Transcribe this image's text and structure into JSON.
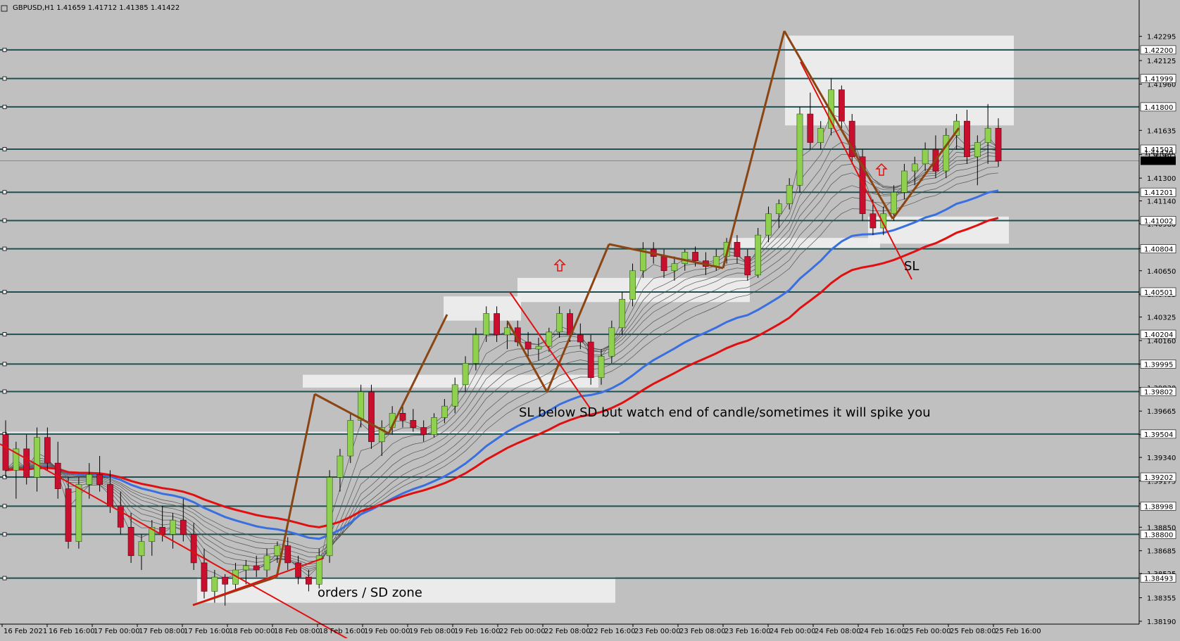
{
  "colors": {
    "background": "#c0c0c0",
    "bull_candle": "#8fd14f",
    "bear_candle": "#c8102e",
    "hline": "#1f4f50",
    "ma_blue": "#3a6fe0",
    "ma_red": "#e01010",
    "ema_thin": "#555555",
    "trend_brown": "#8b4513",
    "trend_red": "#e01010",
    "zone": "#f0f0f0",
    "price_box": "#ffffff",
    "current_box": "#000000"
  },
  "chart_data": {
    "type": "candlestick",
    "title": "GBPUSD,H1  1.41659 1.41712 1.41385 1.41422",
    "symbol": "GBPUSD,H1",
    "ohlc_header": "1.41659 1.41712 1.41385 1.41422",
    "y_axis_side": "right",
    "ylim": [
      1.3817,
      1.4255
    ],
    "y_ticks": [
      "1.42295",
      "1.42125",
      "1.41960",
      "1.41635",
      "1.41465",
      "1.41300",
      "1.41140",
      "1.40980",
      "1.40805",
      "1.40650",
      "1.40485",
      "1.40325",
      "1.40160",
      "1.39995",
      "1.39830",
      "1.39665",
      "1.39500",
      "1.39340",
      "1.39175",
      "1.39015",
      "1.38850",
      "1.38685",
      "1.38525",
      "1.38355",
      "1.38190"
    ],
    "x_ticks": [
      "16 Feb 2021",
      "16 Feb 16:00",
      "17 Feb 00:00",
      "17 Feb 08:00",
      "17 Feb 16:00",
      "18 Feb 00:00",
      "18 Feb 08:00",
      "18 Feb 16:00",
      "19 Feb 00:00",
      "19 Feb 08:00",
      "19 Feb 16:00",
      "22 Feb 00:00",
      "22 Feb 08:00",
      "22 Feb 16:00",
      "23 Feb 00:00",
      "23 Feb 08:00",
      "23 Feb 16:00",
      "24 Feb 00:00",
      "24 Feb 08:00",
      "24 Feb 16:00",
      "25 Feb 00:00",
      "25 Feb 08:00",
      "25 Feb 16:00"
    ],
    "horizontal_levels": [
      "1.42200",
      "1.41999",
      "1.41800",
      "1.41503",
      "1.41201",
      "1.41002",
      "1.40804",
      "1.40501",
      "1.40204",
      "1.39995",
      "1.39802",
      "1.39504",
      "1.39202",
      "1.38998",
      "1.38800",
      "1.38493"
    ],
    "current_price": "1.41422",
    "current_price_secondary": "1.41420",
    "annotations": [
      "SL below SD but watch end of candle/sometimes it will spike you",
      "orders / SD zone",
      "SL"
    ],
    "series": [
      {
        "type": "candles",
        "ohlc": [
          [
            1.395,
            1.396,
            1.392,
            1.3925
          ],
          [
            1.3925,
            1.3945,
            1.3905,
            1.394
          ],
          [
            1.394,
            1.395,
            1.3915,
            1.392
          ],
          [
            1.392,
            1.3955,
            1.391,
            1.3948
          ],
          [
            1.3948,
            1.3955,
            1.3925,
            1.393
          ],
          [
            1.393,
            1.3945,
            1.3905,
            1.3912
          ],
          [
            1.3912,
            1.392,
            1.387,
            1.3875
          ],
          [
            1.3875,
            1.392,
            1.387,
            1.3915
          ],
          [
            1.3915,
            1.393,
            1.3905,
            1.3922
          ],
          [
            1.3922,
            1.3935,
            1.391,
            1.3915
          ],
          [
            1.3915,
            1.3925,
            1.3895,
            1.39
          ],
          [
            1.39,
            1.391,
            1.388,
            1.3885
          ],
          [
            1.3885,
            1.3895,
            1.386,
            1.3865
          ],
          [
            1.3865,
            1.388,
            1.3855,
            1.3875
          ],
          [
            1.3875,
            1.389,
            1.3865,
            1.3885
          ],
          [
            1.3885,
            1.39,
            1.3875,
            1.388
          ],
          [
            1.388,
            1.3895,
            1.387,
            1.389
          ],
          [
            1.389,
            1.3905,
            1.3875,
            1.388
          ],
          [
            1.388,
            1.3888,
            1.3855,
            1.386
          ],
          [
            1.386,
            1.387,
            1.3835,
            1.384
          ],
          [
            1.384,
            1.3855,
            1.3832,
            1.385
          ],
          [
            1.385,
            1.3852,
            1.383,
            1.3845
          ],
          [
            1.3845,
            1.386,
            1.384,
            1.3855
          ],
          [
            1.3855,
            1.3862,
            1.3845,
            1.3858
          ],
          [
            1.3858,
            1.3865,
            1.385,
            1.3855
          ],
          [
            1.3855,
            1.387,
            1.385,
            1.3865
          ],
          [
            1.3865,
            1.3875,
            1.386,
            1.3872
          ],
          [
            1.3872,
            1.3878,
            1.3855,
            1.386
          ],
          [
            1.386,
            1.3865,
            1.3845,
            1.385
          ],
          [
            1.385,
            1.3855,
            1.384,
            1.3845
          ],
          [
            1.3845,
            1.387,
            1.3842,
            1.3865
          ],
          [
            1.3865,
            1.3925,
            1.386,
            1.392
          ],
          [
            1.392,
            1.394,
            1.391,
            1.3935
          ],
          [
            1.3935,
            1.3965,
            1.393,
            1.396
          ],
          [
            1.396,
            1.3985,
            1.3955,
            1.398
          ],
          [
            1.398,
            1.3985,
            1.394,
            1.3945
          ],
          [
            1.3945,
            1.396,
            1.3935,
            1.3955
          ],
          [
            1.3955,
            1.397,
            1.395,
            1.3965
          ],
          [
            1.3965,
            1.397,
            1.3955,
            1.396
          ],
          [
            1.396,
            1.3968,
            1.3952,
            1.3955
          ],
          [
            1.3955,
            1.396,
            1.3945,
            1.395
          ],
          [
            1.395,
            1.3965,
            1.3948,
            1.3962
          ],
          [
            1.3962,
            1.3975,
            1.3958,
            1.397
          ],
          [
            1.397,
            1.399,
            1.3965,
            1.3985
          ],
          [
            1.3985,
            1.4005,
            1.398,
            1.4
          ],
          [
            1.4,
            1.4025,
            1.3995,
            1.402
          ],
          [
            1.402,
            1.404,
            1.4015,
            1.4035
          ],
          [
            1.4035,
            1.404,
            1.4015,
            1.402
          ],
          [
            1.402,
            1.403,
            1.401,
            1.4025
          ],
          [
            1.4025,
            1.403,
            1.4012,
            1.4015
          ],
          [
            1.4015,
            1.4022,
            1.4005,
            1.401
          ],
          [
            1.401,
            1.4018,
            1.4002,
            1.4012
          ],
          [
            1.4012,
            1.4025,
            1.4008,
            1.4022
          ],
          [
            1.4022,
            1.404,
            1.4018,
            1.4035
          ],
          [
            1.4035,
            1.4038,
            1.4015,
            1.402
          ],
          [
            1.402,
            1.4028,
            1.401,
            1.4015
          ],
          [
            1.4015,
            1.402,
            1.3985,
            1.399
          ],
          [
            1.399,
            1.401,
            1.3985,
            1.4005
          ],
          [
            1.4005,
            1.403,
            1.4,
            1.4025
          ],
          [
            1.4025,
            1.405,
            1.402,
            1.4045
          ],
          [
            1.4045,
            1.407,
            1.404,
            1.4065
          ],
          [
            1.4065,
            1.4085,
            1.406,
            1.408
          ],
          [
            1.408,
            1.4085,
            1.407,
            1.4075
          ],
          [
            1.4075,
            1.408,
            1.406,
            1.4065
          ],
          [
            1.4065,
            1.4075,
            1.4058,
            1.407
          ],
          [
            1.407,
            1.408,
            1.4065,
            1.4078
          ],
          [
            1.4078,
            1.4082,
            1.4068,
            1.4072
          ],
          [
            1.4072,
            1.4078,
            1.4062,
            1.4068
          ],
          [
            1.4068,
            1.408,
            1.4065,
            1.4075
          ],
          [
            1.4075,
            1.4088,
            1.407,
            1.4085
          ],
          [
            1.4085,
            1.409,
            1.407,
            1.4075
          ],
          [
            1.4075,
            1.408,
            1.4058,
            1.4062
          ],
          [
            1.4062,
            1.4095,
            1.406,
            1.409
          ],
          [
            1.409,
            1.411,
            1.4085,
            1.4105
          ],
          [
            1.4105,
            1.4115,
            1.4095,
            1.4112
          ],
          [
            1.4112,
            1.413,
            1.4108,
            1.4125
          ],
          [
            1.4125,
            1.418,
            1.412,
            1.4175
          ],
          [
            1.4175,
            1.419,
            1.415,
            1.4155
          ],
          [
            1.4155,
            1.417,
            1.415,
            1.4165
          ],
          [
            1.4165,
            1.42,
            1.416,
            1.4192
          ],
          [
            1.4192,
            1.4195,
            1.4165,
            1.417
          ],
          [
            1.417,
            1.4175,
            1.414,
            1.4145
          ],
          [
            1.4145,
            1.415,
            1.41,
            1.4105
          ],
          [
            1.4105,
            1.4115,
            1.409,
            1.4095
          ],
          [
            1.4095,
            1.411,
            1.409,
            1.4105
          ],
          [
            1.4105,
            1.4125,
            1.41,
            1.412
          ],
          [
            1.412,
            1.414,
            1.4115,
            1.4135
          ],
          [
            1.4135,
            1.4145,
            1.4125,
            1.414
          ],
          [
            1.414,
            1.4155,
            1.4135,
            1.415
          ],
          [
            1.415,
            1.416,
            1.413,
            1.4135
          ],
          [
            1.4135,
            1.4165,
            1.413,
            1.416
          ],
          [
            1.416,
            1.4175,
            1.415,
            1.417
          ],
          [
            1.417,
            1.4178,
            1.414,
            1.4145
          ],
          [
            1.4145,
            1.416,
            1.4125,
            1.4155
          ],
          [
            1.4155,
            1.4182,
            1.414,
            1.4165
          ],
          [
            1.4165,
            1.4172,
            1.4138,
            1.4142
          ]
        ]
      },
      {
        "type": "line",
        "name": "",
        "color": "blue"
      },
      {
        "type": "line",
        "name": "",
        "color": "red"
      }
    ]
  }
}
